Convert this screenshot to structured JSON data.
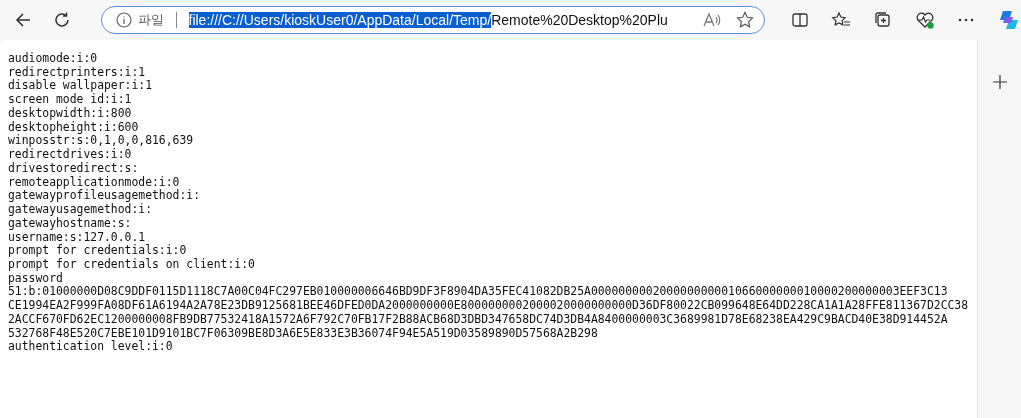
{
  "address_bar": {
    "site_info_label": "파일",
    "url_selected": "file:///C://Users/kioskUser0/AppData/Local/Temp/",
    "url_rest": "Remote%20Desktop%20Plu"
  },
  "file_lines": [
    "audiomode:i:0",
    "redirectprinters:i:1",
    "disable wallpaper:i:1",
    "screen mode id:i:1",
    "desktopwidth:i:800",
    "desktopheight:i:600",
    "winposstr:s:0,1,0,0,816,639",
    "redirectdrives:i:0",
    "drivestoredirect:s:",
    "remoteapplicationmode:i:0",
    "gatewayprofileusagemethod:i:",
    "gatewayusagemethod:i:",
    "gatewayhostname:s:",
    "username:s:127.0.0.1",
    "prompt for credentials:i:0",
    "prompt for credentials on client:i:0",
    "password",
    "51:b:01000000D08C9DDF0115D1118C7A00C04FC297EB010000006646BD9DF3F8904DA35FEC41082DB25A000000000200000000001066000000010000200000003EEF3C13",
    "CE1994EA2F999FA08DF61A6194A2A78E23DB9125681BEE46DFED0DA2000000000E8000000002000020000000000D36DF80022CB099648E64DD228CA1A1A28FFE811367D2CC38",
    "2ACCF670FD62EC1200000008FB9DB77532418A1572A6F792C70FB17F2B88ACB68D3DBD347658DC74D3DB4A8400000003C3689981D78E68238EA429C9BACD40E38D914452A",
    "532768F48E520C7EBE101D9101BC7F06309BE8D3A6E5E833E3B36074F94E5A519D03589890D57568A2B298",
    "authentication level:i:0"
  ]
}
